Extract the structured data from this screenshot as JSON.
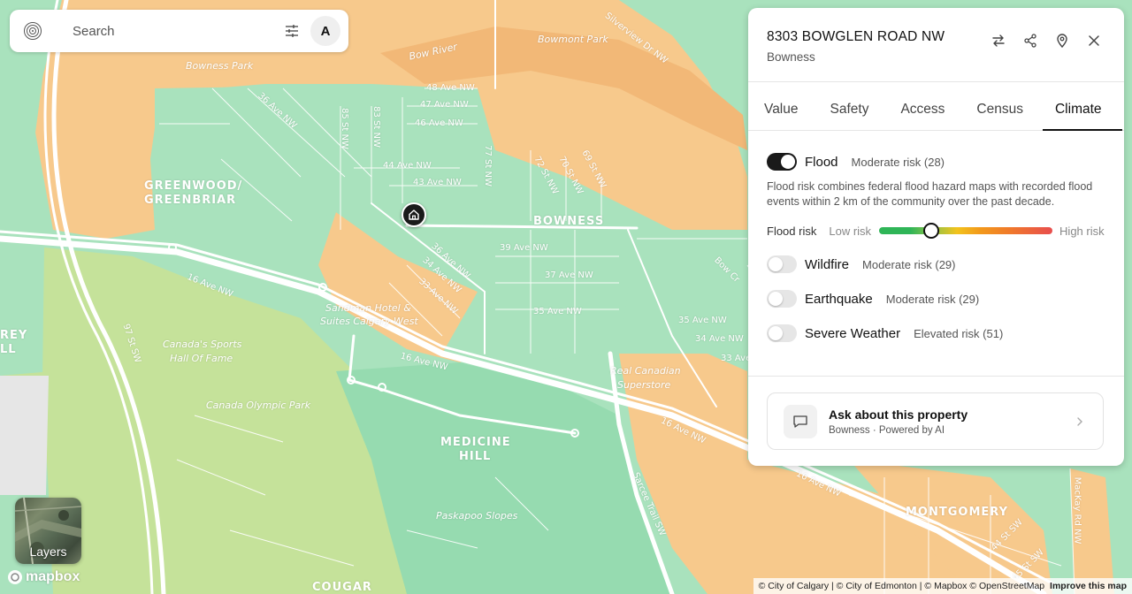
{
  "search": {
    "placeholder": "Search",
    "avatar_initial": "A"
  },
  "map": {
    "street_labels": [
      {
        "text": "48 Ave NW"
      },
      {
        "text": "Bowness Park"
      },
      {
        "text": "47 Ave NW"
      },
      {
        "text": "46 Ave NW"
      },
      {
        "text": "44 Ave NW"
      },
      {
        "text": "43 Ave NW"
      },
      {
        "text": "39 Ave NW"
      },
      {
        "text": "37 Ave NW"
      },
      {
        "text": "35 Ave NW"
      },
      {
        "text": "16 Ave NW"
      },
      {
        "text": "16 Ave NW"
      },
      {
        "text": "16 Ave NW"
      },
      {
        "text": "16 Ave NW"
      },
      {
        "text": "35 Ave NW"
      },
      {
        "text": "34 Ave NW"
      },
      {
        "text": "33 Ave"
      },
      {
        "text": "85 St NW"
      },
      {
        "text": "83 St NW"
      },
      {
        "text": "77 St NW"
      },
      {
        "text": "72 St NW"
      },
      {
        "text": "70 St NW"
      },
      {
        "text": "69 St NW"
      },
      {
        "text": "36 Ave NW"
      },
      {
        "text": "36 Ave NW"
      },
      {
        "text": "34 Ave NW"
      },
      {
        "text": "33 Ave NW"
      },
      {
        "text": "Sarcee Trail SW"
      },
      {
        "text": "Silverview Dr NW"
      },
      {
        "text": "Bow River"
      },
      {
        "text": "Bow Cr"
      },
      {
        "text": "97 St SW"
      },
      {
        "text": "44 St SW"
      },
      {
        "text": "45 St SW"
      },
      {
        "text": "MacKay Rd NW"
      },
      {
        "text": "Bowmont Park"
      }
    ],
    "poi_labels": [
      {
        "text": "Sandman Hotel &"
      },
      {
        "text": "Suites Calgary West"
      },
      {
        "text": "Canada's Sports"
      },
      {
        "text": "Hall Of Fame"
      },
      {
        "text": "Canada Olympic Park"
      },
      {
        "text": "Real Canadian"
      },
      {
        "text": "Superstore"
      },
      {
        "text": "Paskapoo Slopes"
      }
    ],
    "area_labels": [
      {
        "text": "GREENWOOD/"
      },
      {
        "text": "GREENBRIAR"
      },
      {
        "text": "BOWNESS"
      },
      {
        "text": "MEDICINE"
      },
      {
        "text": "HILL"
      },
      {
        "text": "MONTGOMERY"
      },
      {
        "text": "COUGAR"
      },
      {
        "text": "REY"
      },
      {
        "text": "LL"
      }
    ],
    "colors": {
      "low": "#a9e2bd",
      "medium": "#f7c98c",
      "park": "#c5e29a",
      "road": "#ffffff"
    }
  },
  "layers": {
    "label": "Layers"
  },
  "mapbox": {
    "logo_text": "mapbox"
  },
  "attribution": {
    "text": "© City of Calgary | © City of Edmonton | © Mapbox © OpenStreetMap",
    "improve": "Improve this map"
  },
  "panel": {
    "address": "8303 BOWGLEN ROAD NW",
    "neighbourhood": "Bowness",
    "tabs": [
      {
        "label": "Value"
      },
      {
        "label": "Safety"
      },
      {
        "label": "Access"
      },
      {
        "label": "Census"
      },
      {
        "label": "Climate"
      }
    ],
    "active_tab": "Climate",
    "risks": [
      {
        "name": "Flood",
        "level": "Moderate risk (28)",
        "enabled": true
      },
      {
        "name": "Wildfire",
        "level": "Moderate risk (29)",
        "enabled": false
      },
      {
        "name": "Earthquake",
        "level": "Moderate risk (29)",
        "enabled": false
      },
      {
        "name": "Severe Weather",
        "level": "Elevated risk (51)",
        "enabled": false
      }
    ],
    "flood_description": "Flood risk combines federal flood hazard maps with recorded flood events within 2 km of the community over the past decade.",
    "meter": {
      "title": "Flood risk",
      "low_label": "Low risk",
      "high_label": "High risk",
      "value_fraction": 0.3
    },
    "ai_card": {
      "title": "Ask about this property",
      "subtitle": "Bowness · Powered by AI"
    }
  }
}
